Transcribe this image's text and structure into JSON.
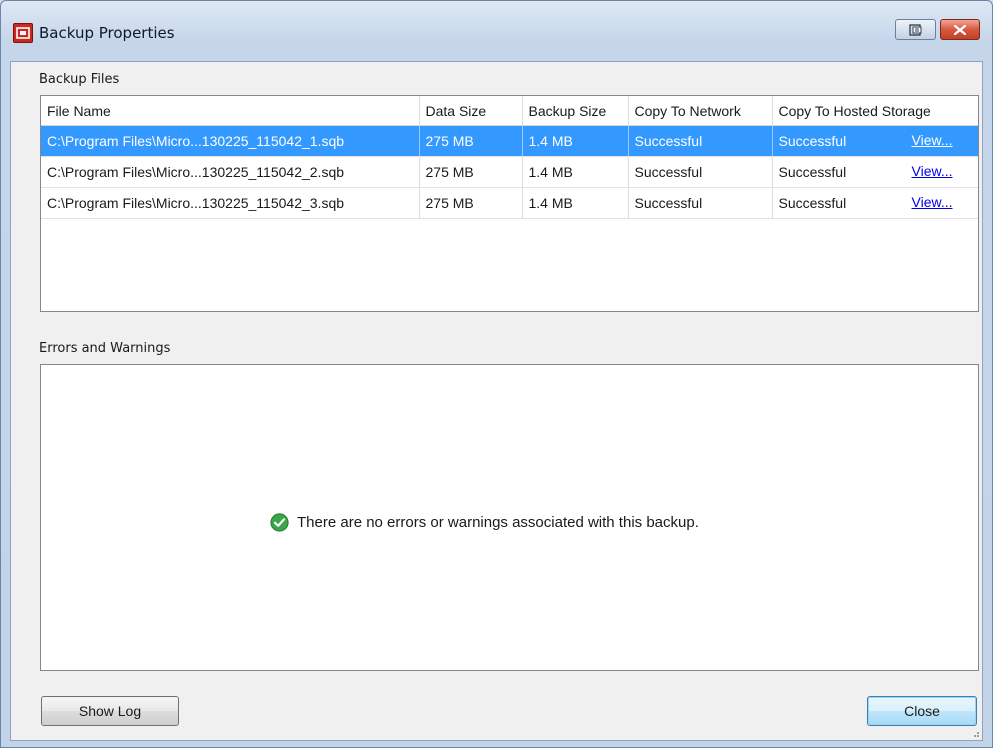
{
  "window": {
    "title": "Backup Properties"
  },
  "backup_files": {
    "label": "Backup Files",
    "columns": [
      "File Name",
      "Data Size",
      "Backup Size",
      "Copy To Network",
      "Copy To Hosted Storage"
    ],
    "rows": [
      {
        "file_name": "C:\\Program Files\\Micro...130225_115042_1.sqb",
        "data_size": "275 MB",
        "backup_size": "1.4 MB",
        "copy_to_network": "Successful",
        "copy_to_hosted": "Successful",
        "link": "View...",
        "selected": true
      },
      {
        "file_name": "C:\\Program Files\\Micro...130225_115042_2.sqb",
        "data_size": "275 MB",
        "backup_size": "1.4 MB",
        "copy_to_network": "Successful",
        "copy_to_hosted": "Successful",
        "link": "View...",
        "selected": false
      },
      {
        "file_name": "C:\\Program Files\\Micro...130225_115042_3.sqb",
        "data_size": "275 MB",
        "backup_size": "1.4 MB",
        "copy_to_network": "Successful",
        "copy_to_hosted": "Successful",
        "link": "View...",
        "selected": false
      }
    ]
  },
  "errors": {
    "label": "Errors and Warnings",
    "message": "There are no errors or warnings associated with this backup.",
    "icon": "check-circle-icon"
  },
  "buttons": {
    "show_log": "Show Log",
    "close": "Close"
  },
  "colors": {
    "selection": "#3399ff",
    "link": "#0000ee",
    "success_icon": "#3aa648",
    "app_icon": "#c92a1f"
  }
}
